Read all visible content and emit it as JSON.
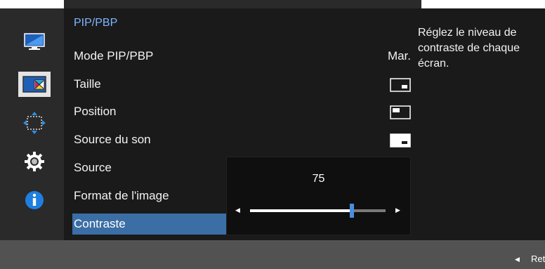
{
  "menu": {
    "title": "PIP/PBP",
    "items": [
      {
        "label": "Mode PIP/PBP",
        "value": "Mar."
      },
      {
        "label": "Taille",
        "icon": "pip-size-icon"
      },
      {
        "label": "Position",
        "icon": "pip-position-icon"
      },
      {
        "label": "Source du son",
        "icon": "sound-source-icon"
      },
      {
        "label": "Source"
      },
      {
        "label": "Format de l'image"
      },
      {
        "label": "Contraste",
        "selected": true
      }
    ]
  },
  "sidebar": {
    "icons": [
      "monitor-icon",
      "pip-pbp-icon",
      "move-arrows-icon",
      "gear-icon",
      "info-icon"
    ],
    "active": "pip-pbp-icon"
  },
  "contrast_popup": {
    "value": "75",
    "level": 75,
    "min": 0,
    "max": 100
  },
  "description": "Réglez le niveau de contraste de chaque écran.",
  "footer": {
    "back_label": "Retour",
    "back_icon": "left-triangle-icon"
  },
  "colors": {
    "accent": "#3b6ea5",
    "title": "#7fb6ff",
    "slider_thumb": "#4a8ee0"
  }
}
